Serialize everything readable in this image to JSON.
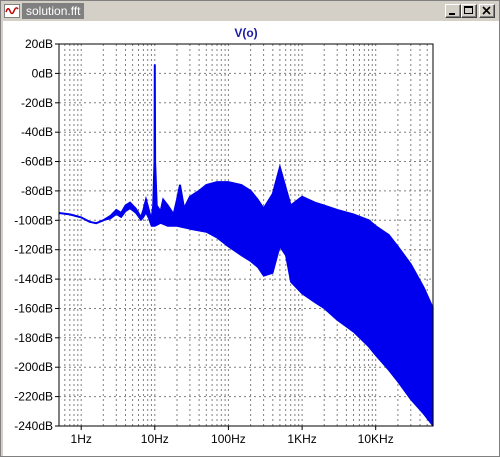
{
  "window": {
    "title": "solution.fft",
    "icon": "waveform-icon",
    "buttons": [
      "minimize-icon",
      "maximize-icon",
      "close-icon"
    ]
  },
  "chart_data": {
    "type": "line",
    "title": "V(o)",
    "xlabel": "",
    "ylabel": "",
    "x_scale": "log",
    "xlim": [
      0.5,
      60000
    ],
    "ylim": [
      -240,
      20
    ],
    "grid": true,
    "x_tick_labels": [
      {
        "value": 1,
        "label": "1Hz"
      },
      {
        "value": 10,
        "label": "10Hz"
      },
      {
        "value": 100,
        "label": "100Hz"
      },
      {
        "value": 1000,
        "label": "1KHz"
      },
      {
        "value": 10000,
        "label": "10KHz"
      }
    ],
    "y_tick_labels": [
      {
        "value": 20,
        "label": "20dB"
      },
      {
        "value": 0,
        "label": "0dB"
      },
      {
        "value": -20,
        "label": "-20dB"
      },
      {
        "value": -40,
        "label": "-40dB"
      },
      {
        "value": -60,
        "label": "-60dB"
      },
      {
        "value": -80,
        "label": "-80dB"
      },
      {
        "value": -100,
        "label": "-100dB"
      },
      {
        "value": -120,
        "label": "-120dB"
      },
      {
        "value": -140,
        "label": "-140dB"
      },
      {
        "value": -160,
        "label": "-160dB"
      },
      {
        "value": -180,
        "label": "-180dB"
      },
      {
        "value": -200,
        "label": "-200dB"
      },
      {
        "value": -220,
        "label": "-220dB"
      },
      {
        "value": -240,
        "label": "-240dB"
      }
    ],
    "series": [
      {
        "color": "#0000ee",
        "rendering": "dense FFT spectrum drawn as min/max envelope",
        "envelope_top": [
          [
            0.5,
            -95
          ],
          [
            0.7,
            -96
          ],
          [
            1,
            -98
          ],
          [
            1.3,
            -101
          ],
          [
            1.6,
            -102
          ],
          [
            2,
            -100
          ],
          [
            2.5,
            -97
          ],
          [
            3,
            -93
          ],
          [
            3.5,
            -95
          ],
          [
            4,
            -90
          ],
          [
            4.6,
            -88
          ],
          [
            5.5,
            -92
          ],
          [
            6.5,
            -98
          ],
          [
            7,
            -93
          ],
          [
            7.6,
            -86
          ],
          [
            8.3,
            -93
          ],
          [
            9,
            -100
          ],
          [
            9.5,
            -90
          ],
          [
            9.9,
            -60
          ],
          [
            10,
            6
          ],
          [
            10.1,
            -60
          ],
          [
            10.6,
            -90
          ],
          [
            12,
            -94
          ],
          [
            13,
            -86
          ],
          [
            15,
            -90
          ],
          [
            18,
            -96
          ],
          [
            20,
            -86
          ],
          [
            22,
            -76
          ],
          [
            25,
            -92
          ],
          [
            30,
            -84
          ],
          [
            40,
            -80
          ],
          [
            50,
            -76
          ],
          [
            70,
            -74
          ],
          [
            100,
            -74
          ],
          [
            150,
            -76
          ],
          [
            200,
            -80
          ],
          [
            250,
            -86
          ],
          [
            300,
            -92
          ],
          [
            400,
            -82
          ],
          [
            500,
            -64
          ],
          [
            600,
            -78
          ],
          [
            700,
            -90
          ],
          [
            1000,
            -84
          ],
          [
            1500,
            -88
          ],
          [
            2000,
            -90
          ],
          [
            3000,
            -93
          ],
          [
            5000,
            -96
          ],
          [
            8000,
            -100
          ],
          [
            10000,
            -104
          ],
          [
            15000,
            -110
          ],
          [
            20000,
            -118
          ],
          [
            30000,
            -130
          ],
          [
            45000,
            -146
          ],
          [
            60000,
            -160
          ]
        ],
        "envelope_bottom": [
          [
            0.5,
            -95
          ],
          [
            0.7,
            -96
          ],
          [
            1,
            -98
          ],
          [
            1.3,
            -101
          ],
          [
            1.6,
            -102
          ],
          [
            2,
            -100
          ],
          [
            2.5,
            -99
          ],
          [
            3,
            -96
          ],
          [
            3.5,
            -98
          ],
          [
            4,
            -94
          ],
          [
            4.6,
            -92
          ],
          [
            5.5,
            -95
          ],
          [
            6.5,
            -100
          ],
          [
            7,
            -98
          ],
          [
            7.6,
            -95
          ],
          [
            8.3,
            -99
          ],
          [
            9,
            -104
          ],
          [
            10,
            -104
          ],
          [
            12,
            -102
          ],
          [
            15,
            -104
          ],
          [
            20,
            -104
          ],
          [
            30,
            -106
          ],
          [
            50,
            -108
          ],
          [
            70,
            -112
          ],
          [
            100,
            -118
          ],
          [
            150,
            -124
          ],
          [
            200,
            -128
          ],
          [
            250,
            -132
          ],
          [
            300,
            -138
          ],
          [
            400,
            -136
          ],
          [
            500,
            -118
          ],
          [
            600,
            -124
          ],
          [
            700,
            -142
          ],
          [
            1000,
            -150
          ],
          [
            1500,
            -156
          ],
          [
            2000,
            -160
          ],
          [
            3000,
            -168
          ],
          [
            5000,
            -176
          ],
          [
            8000,
            -186
          ],
          [
            10000,
            -192
          ],
          [
            15000,
            -202
          ],
          [
            20000,
            -210
          ],
          [
            30000,
            -222
          ],
          [
            45000,
            -232
          ],
          [
            60000,
            -240
          ]
        ]
      }
    ]
  }
}
